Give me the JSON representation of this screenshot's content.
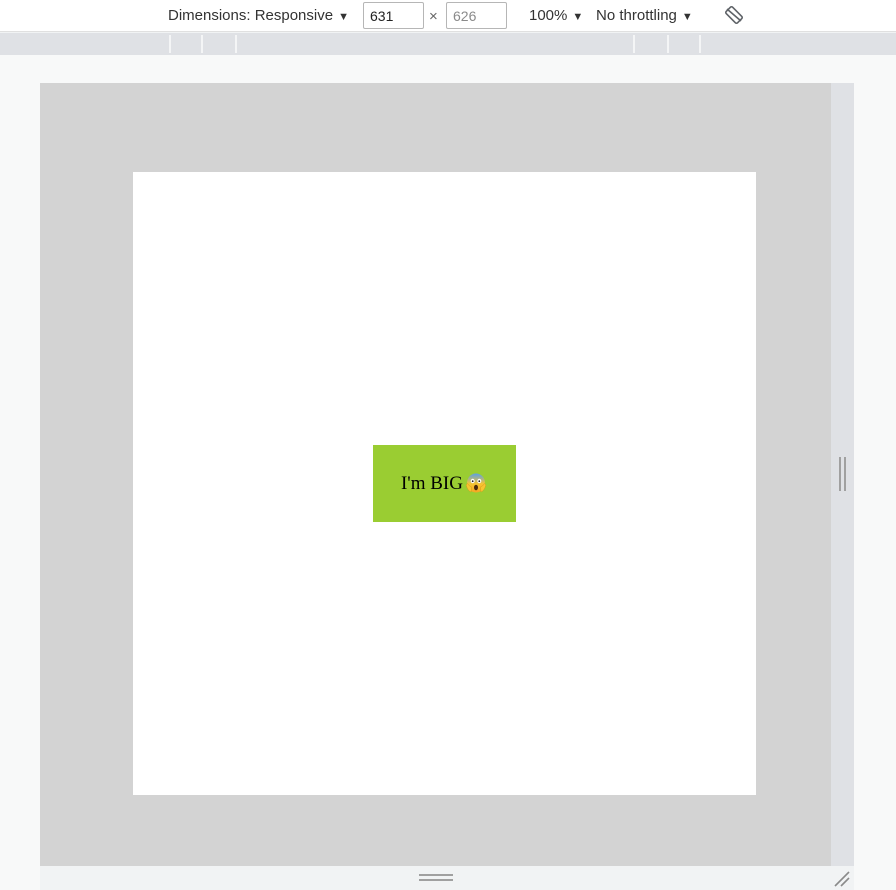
{
  "toolbar": {
    "dimensions_label": "Dimensions: Responsive",
    "width_value": "631",
    "height_placeholder": "626",
    "times": "×",
    "zoom": "100%",
    "throttling": "No throttling",
    "caret": "▼"
  },
  "page": {
    "box_text": "I'm BIG",
    "box_emoji_icon": "face-screaming-in-fear-icon",
    "box_color": "#9acd32"
  },
  "colors": {
    "device_frame": "#d3d3d3",
    "page_background": "#ffffff",
    "ruler": "#dfe1e5"
  }
}
